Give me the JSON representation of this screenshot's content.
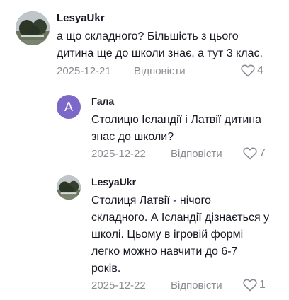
{
  "comments": [
    {
      "username": "LesyaUkr",
      "avatar_icon": "profile-photo",
      "text_lines": [
        "а що складного? Більшість з цього",
        "дитина ще до школи знає, а тут 3 клас."
      ],
      "date": "2025-12-21",
      "reply_label": "Відповісти",
      "likes": "4"
    },
    {
      "username": "Гала",
      "avatar_letter": "А",
      "text_lines": [
        "Столицю Ісландії і Латвії дитина",
        "знає до школи?"
      ],
      "date": "2025-12-22",
      "reply_label": "Відповісти",
      "likes": "7"
    },
    {
      "username": "LesyaUkr",
      "avatar_icon": "profile-photo",
      "text_lines": [
        "Столиця Латвії - нічого",
        "складного. А Ісландії дізнається у",
        "школі. Цьому в ігровій формі",
        "легко можно навчити до 6-7",
        "років."
      ],
      "date": "2025-12-22",
      "reply_label": "Відповісти",
      "likes": "1"
    }
  ],
  "colors": {
    "text": "#161823",
    "meta": "#8a8b91",
    "letter_avatar": "#7b68c9"
  },
  "icons": {
    "like": "heart-outline-icon"
  }
}
